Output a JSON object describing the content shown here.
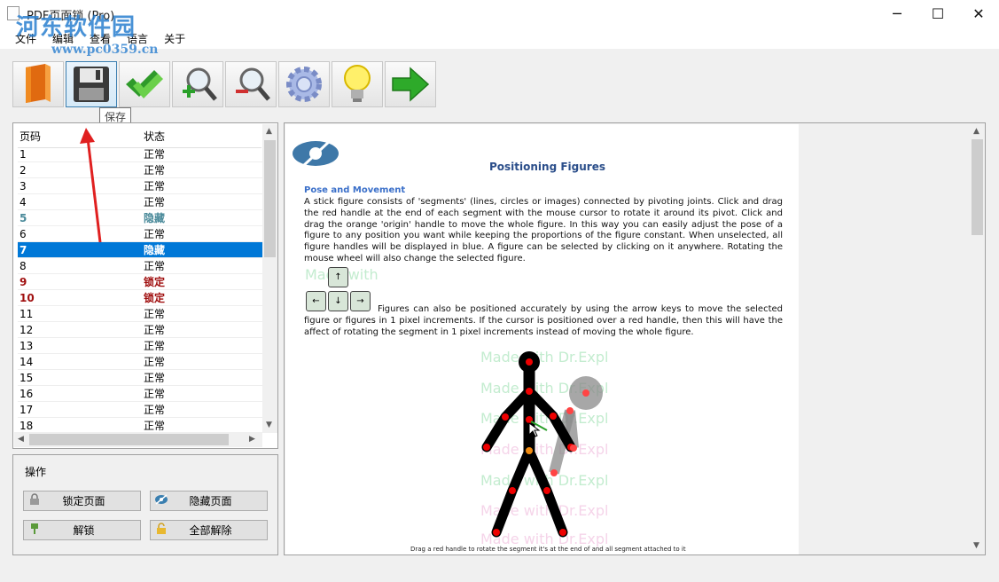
{
  "window": {
    "title": "PDF页面锁 (Pro)",
    "watermark": "河东软件园",
    "watermark_url": "www.pc0359.cn",
    "minimize": "─",
    "maximize": "☐",
    "close": "✕"
  },
  "menu": [
    "文件",
    "编辑",
    "查看",
    "语言",
    "关于"
  ],
  "toolbar": {
    "buttons": [
      {
        "name": "open-book-icon"
      },
      {
        "name": "save-icon"
      },
      {
        "name": "double-check-icon"
      },
      {
        "name": "zoom-in-icon"
      },
      {
        "name": "zoom-out-icon"
      },
      {
        "name": "gear-icon"
      },
      {
        "name": "lightbulb-icon"
      },
      {
        "name": "next-arrow-icon"
      }
    ],
    "tooltip": "保存"
  },
  "page_list": {
    "headers": [
      "页码",
      "状态"
    ],
    "rows": [
      {
        "page": "1",
        "state": "正常",
        "kind": "normal"
      },
      {
        "page": "2",
        "state": "正常",
        "kind": "normal"
      },
      {
        "page": "3",
        "state": "正常",
        "kind": "normal"
      },
      {
        "page": "4",
        "state": "正常",
        "kind": "normal"
      },
      {
        "page": "5",
        "state": "隐藏",
        "kind": "hidden"
      },
      {
        "page": "6",
        "state": "正常",
        "kind": "normal"
      },
      {
        "page": "7",
        "state": "隐藏",
        "kind": "selected"
      },
      {
        "page": "8",
        "state": "正常",
        "kind": "normal"
      },
      {
        "page": "9",
        "state": "锁定",
        "kind": "locked"
      },
      {
        "page": "10",
        "state": "锁定",
        "kind": "locked"
      },
      {
        "page": "11",
        "state": "正常",
        "kind": "normal"
      },
      {
        "page": "12",
        "state": "正常",
        "kind": "normal"
      },
      {
        "page": "13",
        "state": "正常",
        "kind": "normal"
      },
      {
        "page": "14",
        "state": "正常",
        "kind": "normal"
      },
      {
        "page": "15",
        "state": "正常",
        "kind": "normal"
      },
      {
        "page": "16",
        "state": "正常",
        "kind": "normal"
      },
      {
        "page": "17",
        "state": "正常",
        "kind": "normal"
      },
      {
        "page": "18",
        "state": "正常",
        "kind": "normal"
      }
    ]
  },
  "operations": {
    "title": "操作",
    "lock_page": "锁定页面",
    "hide_page": "隐藏页面",
    "unlock": "解锁",
    "unlock_all": "全部解除"
  },
  "document": {
    "title": "Positioning Figures",
    "subtitle": "Pose and Movement",
    "para1": "A stick figure consists of 'segments' (lines, circles or images) connected by pivoting joints. Click and drag the red handle at the end of each segment with the mouse cursor to rotate it around its pivot. Click and drag the orange 'origin' handle to move the whole figure. In this way you can easily adjust the pose of a figure to any position you want while keeping the proportions of the figure constant. When unselected, all figure handles will be displayed in blue. A figure can be selected by clicking on it anywhere. Rotating the mouse wheel will also change the selected figure.",
    "para2": "Figures can also be positioned accurately by using the arrow keys to move the selected figure or figures in 1 pixel increments. If the cursor is positioned over a red handle, then this will have the affect of rotating the segment in 1 pixel increments instead of moving the whole figure.",
    "caption": "Drag a red handle to rotate the segment it's at the end of and all segment attached to it",
    "keys": {
      "up": "↑",
      "left": "←",
      "down": "↓",
      "right": "→"
    },
    "ghost_texts": [
      "Made with",
      "Made with Dr.Expl",
      "Made with Dr.Expl",
      "Made with Dr.Expl",
      "Made with Dr.Expl",
      "Made with Dr.Expl",
      "Made with Dr.Expl",
      "Made with Dr.Expl"
    ]
  },
  "scroll_arrows": {
    "up": "▲",
    "down": "▼",
    "left": "◀",
    "right": "▶"
  },
  "colors": {
    "selection": "#0078d7",
    "hidden": "#4a8a9a",
    "locked": "#a01010",
    "doc_title": "#2b4e8a"
  }
}
